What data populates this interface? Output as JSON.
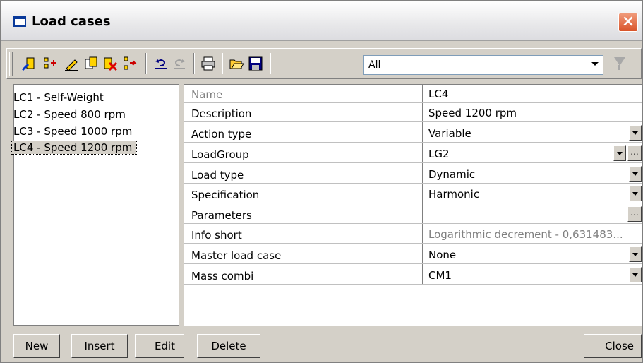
{
  "window": {
    "title": "Load cases",
    "close_glyph": "×"
  },
  "toolbar": {
    "icons": [
      "new-icon",
      "insert-icon",
      "edit-icon",
      "copy-icon",
      "delete-icon",
      "move-icon",
      "undo-icon",
      "redo-icon",
      "print-icon",
      "open-icon",
      "save-icon"
    ],
    "filter_value": "All",
    "ellipsis": "..."
  },
  "list": {
    "items": [
      "LC1 - Self-Weight",
      "LC2 - Speed 800 rpm",
      "LC3 - Speed 1000 rpm",
      "LC4 - Speed 1200 rpm"
    ],
    "selected_index": 3
  },
  "properties": {
    "rows": [
      {
        "name": "Name",
        "value": "LC4"
      },
      {
        "name": "Description",
        "value": "Speed 1200 rpm"
      },
      {
        "name": "Action type",
        "value": "Variable"
      },
      {
        "name": "LoadGroup",
        "value": "LG2"
      },
      {
        "name": "Load type",
        "value": "Dynamic"
      },
      {
        "name": "Specification",
        "value": "Harmonic"
      },
      {
        "name": "Parameters",
        "value": ""
      },
      {
        "name": "Info short",
        "value": "Logarithmic decrement - 0,631483..."
      },
      {
        "name": "Master load case",
        "value": "None"
      },
      {
        "name": "Mass combi",
        "value": "CM1"
      }
    ]
  },
  "buttons": {
    "new": "New",
    "insert": "Insert",
    "edit": "Edit",
    "delete": "Delete",
    "close": "Close"
  },
  "colors": {
    "face": "#d4d0c8",
    "accent": "#d9542a"
  }
}
